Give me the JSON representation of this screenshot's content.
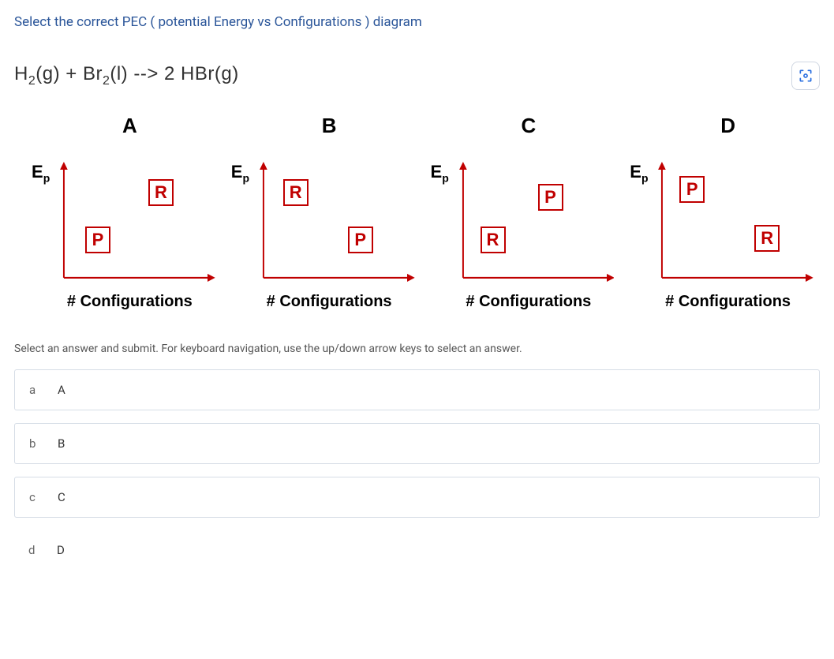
{
  "question": "Select the correct PEC ( potential Energy vs Configurations ) diagram",
  "equation": {
    "h2": "H",
    "h2sub": "2",
    "h2state": "(g)",
    "plus": " + ",
    "br2": "Br",
    "br2sub": "2",
    "br2state": "(l)",
    "arrow": " --> ",
    "prod": "2 HBr(g)"
  },
  "yAxis": {
    "E": "E",
    "p": "p"
  },
  "xAxis": "# Configurations",
  "diagrams": {
    "A": {
      "title": "A",
      "left": "P",
      "right": "R"
    },
    "B": {
      "title": "B",
      "left": "R",
      "right": "P"
    },
    "C": {
      "title": "C",
      "left": "R",
      "right": "P"
    },
    "D": {
      "title": "D",
      "left": "P",
      "right": "R"
    }
  },
  "instructions": "Select an answer and submit. For keyboard navigation, use the up/down arrow keys to select an answer.",
  "options": {
    "a": {
      "key": "a",
      "label": "A"
    },
    "b": {
      "key": "b",
      "label": "B"
    },
    "c": {
      "key": "c",
      "label": "C"
    },
    "d": {
      "key": "d",
      "label": "D"
    }
  },
  "chart_data": [
    {
      "id": "A",
      "type": "scatter",
      "title": "A",
      "xlabel": "# Configurations",
      "ylabel": "Ep",
      "series": [
        {
          "name": "P",
          "role": "products",
          "position": "left",
          "energy": "low"
        },
        {
          "name": "R",
          "role": "reactants",
          "position": "right",
          "energy": "high"
        }
      ]
    },
    {
      "id": "B",
      "type": "scatter",
      "title": "B",
      "xlabel": "# Configurations",
      "ylabel": "Ep",
      "series": [
        {
          "name": "R",
          "role": "reactants",
          "position": "left",
          "energy": "high"
        },
        {
          "name": "P",
          "role": "products",
          "position": "right",
          "energy": "low"
        }
      ]
    },
    {
      "id": "C",
      "type": "scatter",
      "title": "C",
      "xlabel": "# Configurations",
      "ylabel": "Ep",
      "series": [
        {
          "name": "R",
          "role": "reactants",
          "position": "left",
          "energy": "low"
        },
        {
          "name": "P",
          "role": "products",
          "position": "right",
          "energy": "high"
        }
      ]
    },
    {
      "id": "D",
      "type": "scatter",
      "title": "D",
      "xlabel": "# Configurations",
      "ylabel": "Ep",
      "series": [
        {
          "name": "P",
          "role": "products",
          "position": "left",
          "energy": "high"
        },
        {
          "name": "R",
          "role": "reactants",
          "position": "right",
          "energy": "low"
        }
      ]
    }
  ]
}
